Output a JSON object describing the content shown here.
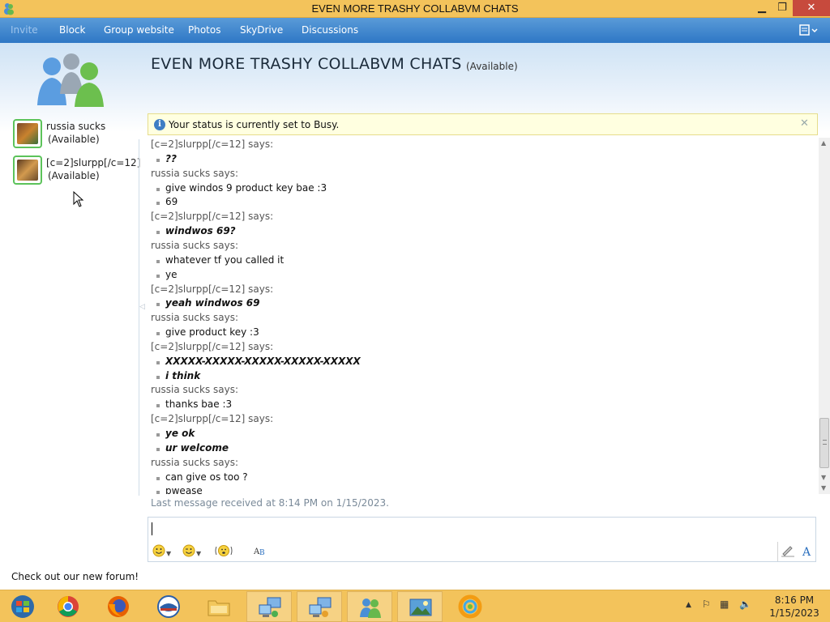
{
  "window": {
    "title": "EVEN MORE TRASHY COLLABVM CHATS",
    "controls": {
      "minimize": "▁",
      "maximize": "❐",
      "close": "✕"
    }
  },
  "nav": {
    "items": [
      "Invite",
      "Block",
      "Group website",
      "Photos",
      "SkyDrive",
      "Discussions"
    ],
    "menu_icon": "menu-icon"
  },
  "sidebar": {
    "contacts": [
      {
        "name": "russia sucks",
        "status": "(Available)"
      },
      {
        "name": "[c=2]slurpp[/c=12]",
        "status": "(Available)"
      }
    ],
    "forum_link": "Check out our new forum!"
  },
  "chat": {
    "title": "EVEN MORE TRASHY COLLABVM CHATS",
    "status": "(Available)",
    "info_bar": "Your status is currently set to Busy.",
    "messages": [
      {
        "type": "sender",
        "text": "[c=2]slurpp[/c=12] says:"
      },
      {
        "type": "text",
        "text": "??",
        "emph": true
      },
      {
        "type": "sender",
        "text": "russia sucks says:"
      },
      {
        "type": "text",
        "text": "give windos 9 product key bae :3",
        "emph": false
      },
      {
        "type": "text",
        "text": "69",
        "emph": false
      },
      {
        "type": "sender",
        "text": "[c=2]slurpp[/c=12] says:"
      },
      {
        "type": "text",
        "text": "windwos 69?",
        "emph": true
      },
      {
        "type": "sender",
        "text": "russia sucks says:"
      },
      {
        "type": "text",
        "text": "whatever tf you called it",
        "emph": false
      },
      {
        "type": "text",
        "text": "ye",
        "emph": false
      },
      {
        "type": "sender",
        "text": "[c=2]slurpp[/c=12] says:"
      },
      {
        "type": "text",
        "text": "yeah windwos 69",
        "emph": true
      },
      {
        "type": "sender",
        "text": "russia sucks says:"
      },
      {
        "type": "text",
        "text": "give product key :3",
        "emph": false
      },
      {
        "type": "sender",
        "text": "[c=2]slurpp[/c=12] says:"
      },
      {
        "type": "text",
        "text": "XXXXX-XXXXX-XXXXX-XXXXX-XXXXX",
        "emph": true
      },
      {
        "type": "text",
        "text": "i think",
        "emph": true
      },
      {
        "type": "sender",
        "text": "russia sucks says:"
      },
      {
        "type": "text",
        "text": "thanks bae :3",
        "emph": false
      },
      {
        "type": "sender",
        "text": "[c=2]slurpp[/c=12] says:"
      },
      {
        "type": "text",
        "text": "ye ok",
        "emph": true
      },
      {
        "type": "text",
        "text": "ur welcome",
        "emph": true
      },
      {
        "type": "sender",
        "text": "russia sucks says:"
      },
      {
        "type": "text",
        "text": "can give os too ?",
        "emph": false
      },
      {
        "type": "text",
        "text": "pwease",
        "emph": false
      }
    ],
    "last_message": "Last message received at 8:14 PM on 1/15/2023.",
    "input_value": "",
    "toolbar": {
      "emoticon_icon": "smiley-icon",
      "wink_icon": "wink-icon",
      "nudge_icon": "nudge-icon",
      "font_icon": "font-icon",
      "handwriting_icon": "handwriting-icon",
      "text_icon": "text-format-icon"
    }
  },
  "taskbar": {
    "apps": [
      "start-orb",
      "chrome",
      "firefox",
      "windows-live",
      "file-explorer",
      "network-connection",
      "remote-desktop",
      "messenger",
      "photo-viewer",
      "live-gallery"
    ],
    "time": "8:16 PM",
    "date": "1/15/2023"
  },
  "colors": {
    "titlebar": "#f3c35b",
    "navbar": "#3f86cf",
    "close_button": "#c74a3d",
    "infobar": "#ffffe0"
  }
}
